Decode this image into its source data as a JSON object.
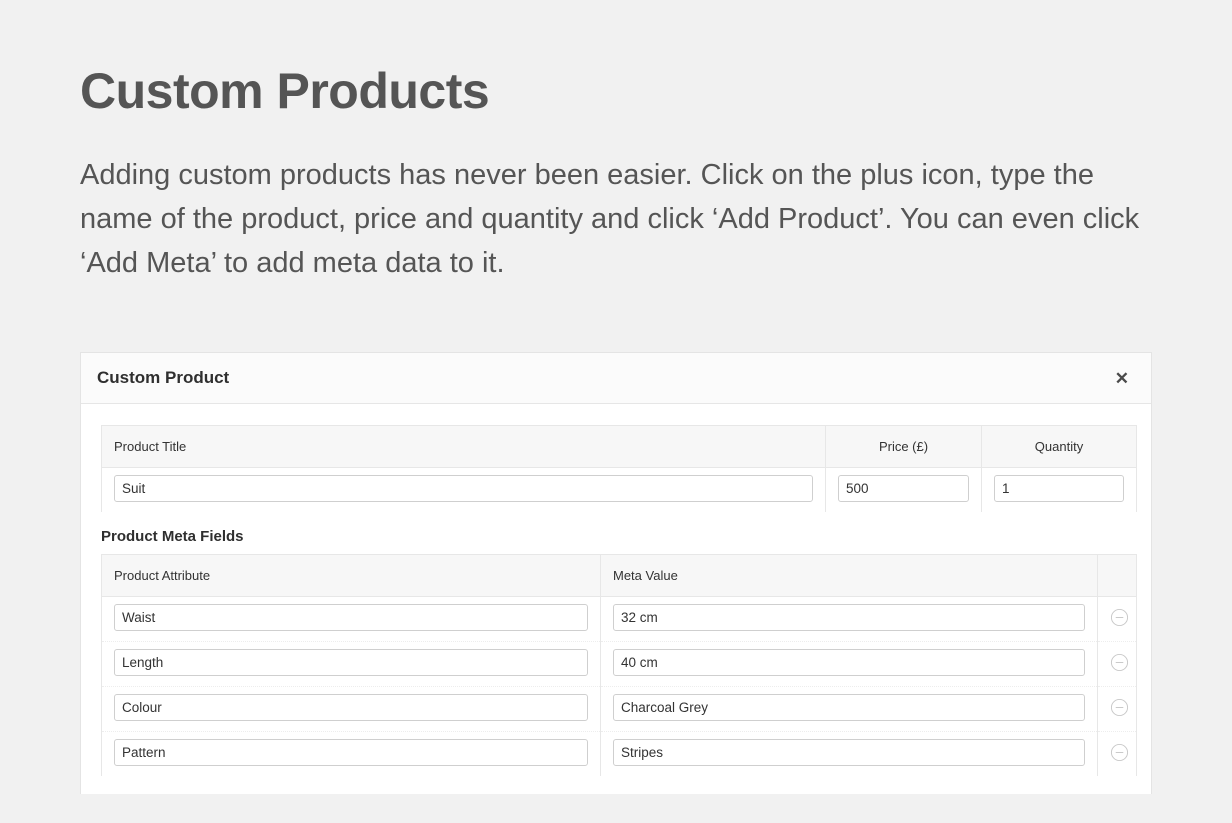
{
  "intro": {
    "title": "Custom Products",
    "description": "Adding custom products has never been easier. Click on the plus icon, type the name of the product, price and quantity and click ‘Add Product’. You can even click ‘Add Meta’ to add meta data to it."
  },
  "card": {
    "title": "Custom Product",
    "close_label": "✕"
  },
  "product_table": {
    "headers": {
      "title": "Product Title",
      "price": "Price (£)",
      "quantity": "Quantity"
    },
    "row": {
      "title_value": "Suit",
      "price_value": "500",
      "quantity_value": "1"
    }
  },
  "meta_section": {
    "label": "Product Meta Fields",
    "headers": {
      "attribute": "Product Attribute",
      "value": "Meta Value",
      "action": ""
    },
    "rows": [
      {
        "attribute": "Waist",
        "value": "32 cm",
        "remove_icon": "minus-circle-icon"
      },
      {
        "attribute": "Length",
        "value": "40 cm",
        "remove_icon": "minus-circle-icon"
      },
      {
        "attribute": "Colour",
        "value": "Charcoal Grey",
        "remove_icon": "minus-circle-icon"
      },
      {
        "attribute": "Pattern",
        "value": "Stripes",
        "remove_icon": "minus-circle-icon"
      }
    ]
  },
  "colors": {
    "page_background": "#f1f1f1",
    "card_background": "#ffffff",
    "header_background": "#fbfbfb",
    "table_header_background": "#f7f7f7",
    "text_primary": "#2f2f2f",
    "text_muted": "#555555",
    "border": "#e7e7e7",
    "input_border": "#cfcfcf",
    "icon_grey": "#c8c8c8"
  }
}
